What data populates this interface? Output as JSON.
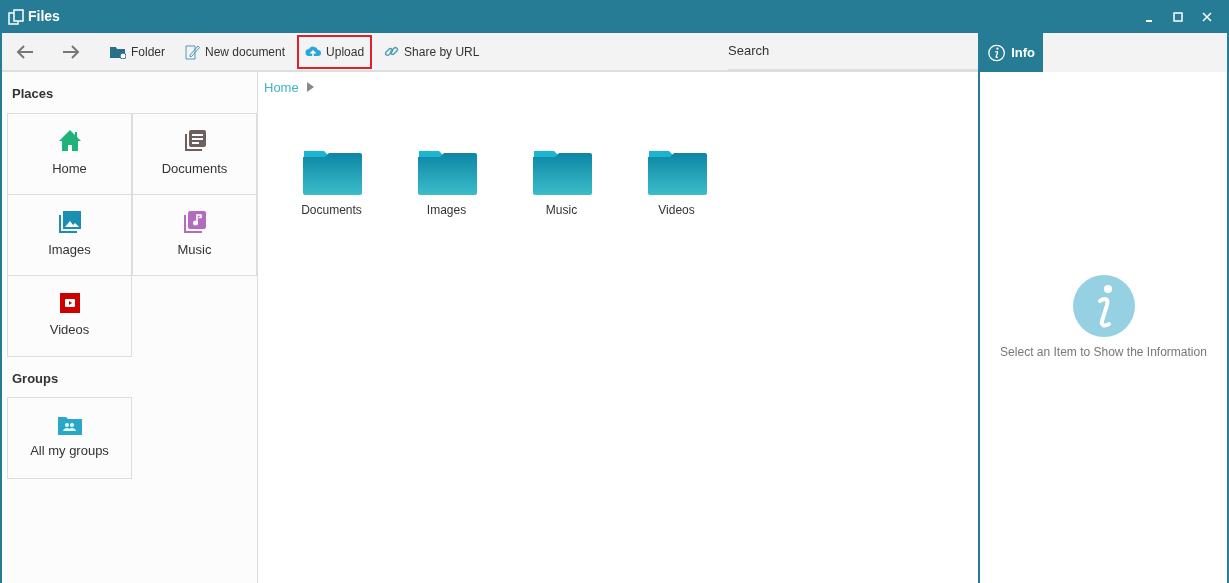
{
  "window": {
    "title": "Files"
  },
  "toolbar": {
    "buttons": [
      {
        "kind": "folder",
        "label": "Folder",
        "highlighted": false
      },
      {
        "kind": "document",
        "label": "New document",
        "highlighted": false
      },
      {
        "kind": "upload",
        "label": "Upload",
        "highlighted": true
      },
      {
        "kind": "link",
        "label": "Share by URL",
        "highlighted": false
      }
    ],
    "search": {
      "placeholder": "Search"
    }
  },
  "info_tab": {
    "label": "Info"
  },
  "sidebar": {
    "sections": [
      {
        "title": "Places",
        "items": [
          {
            "kind": "home",
            "label": "Home"
          },
          {
            "kind": "documents",
            "label": "Documents"
          },
          {
            "kind": "images",
            "label": "Images"
          },
          {
            "kind": "music",
            "label": "Music"
          },
          {
            "kind": "videos",
            "label": "Videos"
          }
        ]
      },
      {
        "title": "Groups",
        "items": [
          {
            "kind": "groups",
            "label": "All my groups"
          }
        ]
      }
    ]
  },
  "breadcrumb": [
    {
      "label": "Home"
    }
  ],
  "folders": [
    {
      "label": "Documents"
    },
    {
      "label": "Images"
    },
    {
      "label": "Music"
    },
    {
      "label": "Videos"
    }
  ],
  "info_panel": {
    "message": "Select an Item to Show the Information"
  }
}
